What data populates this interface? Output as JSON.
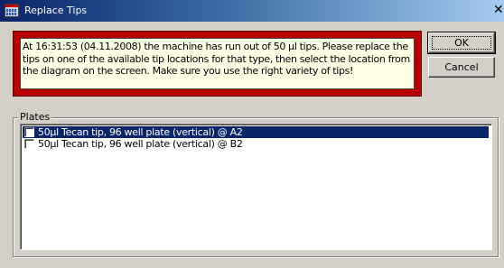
{
  "window": {
    "title": "Replace Tips",
    "close_glyph": "✕"
  },
  "message": {
    "text": "At 16:31:53 (04.11.2008) the machine has run out of 50 µl tips. Please replace the tips on one of the available tip locations for that type, then select the location from the diagram on the screen. Make sure you use the right variety of tips!",
    "frame_color": "#b80000",
    "background_color": "#ffffe6"
  },
  "buttons": {
    "ok_label": "OK",
    "cancel_label": "Cancel"
  },
  "plates": {
    "label": "Plates",
    "items": [
      {
        "label": "50µl Tecan tip, 96 well plate (vertical) @ A2",
        "checked": false,
        "selected": true
      },
      {
        "label": "50µl Tecan tip, 96 well plate (vertical) @ B2",
        "checked": false,
        "selected": false
      }
    ],
    "selection_color": "#0a246a"
  }
}
